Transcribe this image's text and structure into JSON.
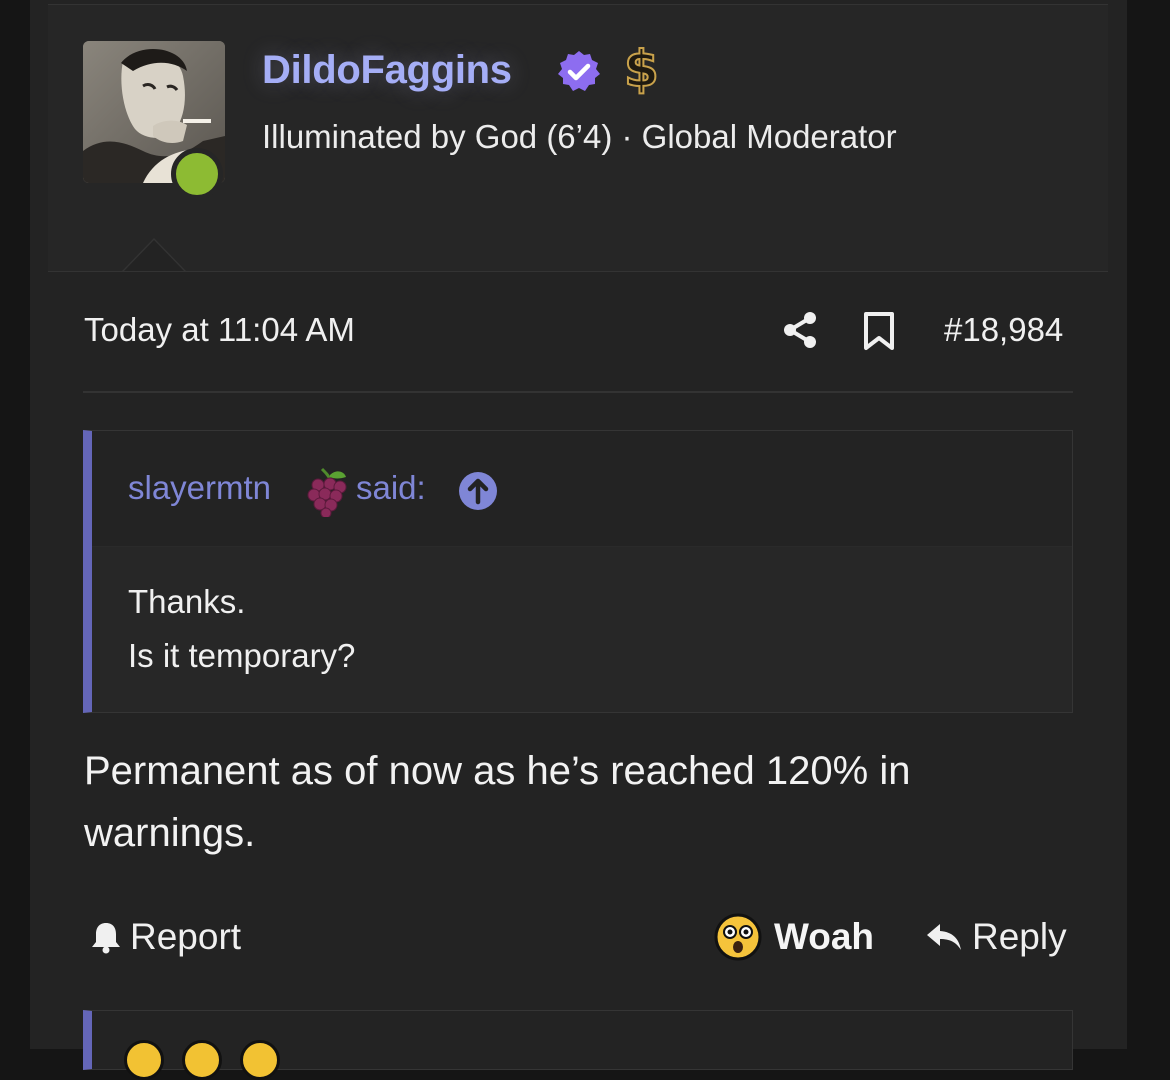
{
  "user": {
    "name": "DildoFaggins",
    "title": "Illuminated by God (6’4) · Global Moderator",
    "badge_icon": "verified-check-icon",
    "donor_icon": "dollar-icon",
    "online": true
  },
  "post": {
    "date": "Today at 11:04 AM",
    "number": "#18,984",
    "body": "Permanent as of now as he’s reached 120% in warnings."
  },
  "quote": {
    "author": "slayermtn",
    "author_emoji": "grapes-icon",
    "said": "said:",
    "lines": [
      "Thanks.",
      "Is it temporary?"
    ]
  },
  "actions": {
    "report_label": "Report",
    "reaction_label": "Woah",
    "reply_label": "Reply"
  },
  "colors": {
    "username": "#a5aef6",
    "quote_accent": "#6466b8",
    "online": "#8dbb33",
    "background": "#232323"
  }
}
